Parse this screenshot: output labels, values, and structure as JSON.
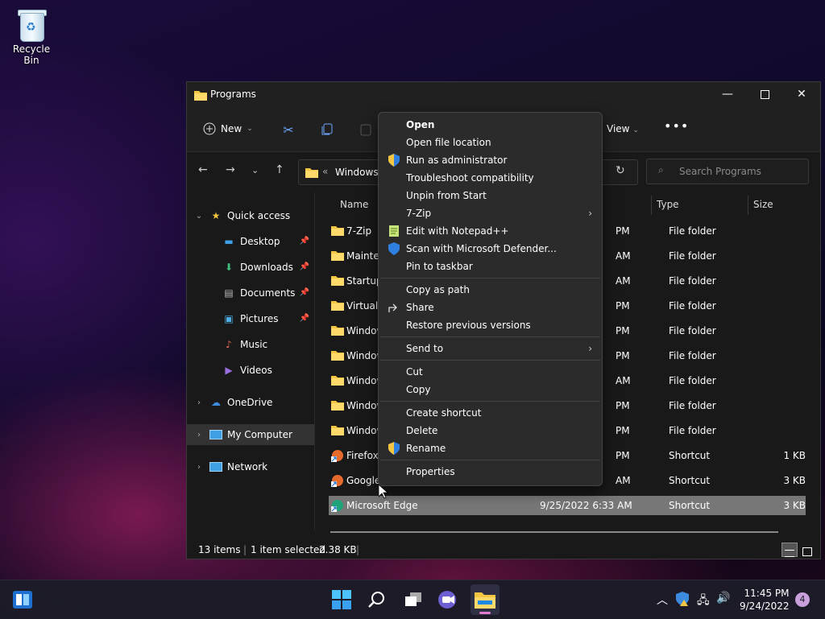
{
  "desktop": {
    "recycle_bin_label": "Recycle Bin"
  },
  "window": {
    "title": "Programs",
    "toolbar": {
      "new_label": "New",
      "view_label": "View"
    },
    "address": {
      "path_prefix": "«",
      "path_text": "Windows"
    },
    "search_placeholder": "Search Programs"
  },
  "nav": {
    "quick_access": "Quick access",
    "items": [
      {
        "label": "Desktop",
        "icon": "desktop-icon",
        "pinned": true
      },
      {
        "label": "Downloads",
        "icon": "download-icon",
        "pinned": true
      },
      {
        "label": "Documents",
        "icon": "document-icon",
        "pinned": true
      },
      {
        "label": "Pictures",
        "icon": "picture-icon",
        "pinned": true
      },
      {
        "label": "Music",
        "icon": "music-icon",
        "pinned": false
      },
      {
        "label": "Videos",
        "icon": "video-icon",
        "pinned": false
      }
    ],
    "onedrive": "OneDrive",
    "my_computer": "My Computer",
    "network": "Network"
  },
  "columns": {
    "name": "Name",
    "type": "Type",
    "size": "Size"
  },
  "files": [
    {
      "name": "7-Zip",
      "date": "PM",
      "type": "File folder",
      "size": ""
    },
    {
      "name": "Mainter",
      "date": "AM",
      "type": "File folder",
      "size": ""
    },
    {
      "name": "Startup",
      "date": "AM",
      "type": "File folder",
      "size": ""
    },
    {
      "name": "Virtual /",
      "date": "PM",
      "type": "File folder",
      "size": ""
    },
    {
      "name": "Window",
      "date": "PM",
      "type": "File folder",
      "size": ""
    },
    {
      "name": "Window",
      "date": "PM",
      "type": "File folder",
      "size": ""
    },
    {
      "name": "Window",
      "date": "AM",
      "type": "File folder",
      "size": ""
    },
    {
      "name": "Window",
      "date": "PM",
      "type": "File folder",
      "size": ""
    },
    {
      "name": "Window",
      "date": "PM",
      "type": "File folder",
      "size": ""
    },
    {
      "name": "Firefox",
      "date": "PM",
      "type": "Shortcut",
      "size": "1 KB"
    },
    {
      "name": "Google",
      "date": "AM",
      "type": "Shortcut",
      "size": "3 KB"
    },
    {
      "name": "Microsoft Edge",
      "date": "9/25/2022 6:33 AM",
      "type": "Shortcut",
      "size": "3 KB"
    }
  ],
  "status": {
    "items": "13 items",
    "selected": "1 item selected",
    "size": "2.38 KB"
  },
  "context_menu": {
    "group1": [
      {
        "label": "Open",
        "icon": "",
        "bold": true
      },
      {
        "label": "Open file location",
        "icon": ""
      },
      {
        "label": "Run as administrator",
        "icon": "uac-shield-icon"
      },
      {
        "label": "Troubleshoot compatibility",
        "icon": ""
      },
      {
        "label": "Unpin from Start",
        "icon": ""
      },
      {
        "label": "7-Zip",
        "icon": "",
        "submenu": true
      },
      {
        "label": "Edit with Notepad++",
        "icon": "notepad-plus-icon"
      },
      {
        "label": "Scan with Microsoft Defender...",
        "icon": "defender-shield-icon"
      },
      {
        "label": "Pin to taskbar",
        "icon": ""
      }
    ],
    "group2": [
      {
        "label": "Copy as path",
        "icon": ""
      },
      {
        "label": "Share",
        "icon": "share-icon"
      },
      {
        "label": "Restore previous versions",
        "icon": ""
      }
    ],
    "group3": [
      {
        "label": "Send to",
        "icon": "",
        "submenu": true
      }
    ],
    "group4": [
      {
        "label": "Cut",
        "icon": ""
      },
      {
        "label": "Copy",
        "icon": ""
      }
    ],
    "group5": [
      {
        "label": "Create shortcut",
        "icon": ""
      },
      {
        "label": "Delete",
        "icon": ""
      },
      {
        "label": "Rename",
        "icon": "uac-shield-icon"
      }
    ],
    "group6": [
      {
        "label": "Properties",
        "icon": ""
      }
    ]
  },
  "taskbar": {
    "time": "11:45 PM",
    "date": "9/24/2022",
    "notification_count": "4"
  },
  "colors": {
    "accent": "#0078d4",
    "folder": "#f4c542",
    "window_bg": "#191919"
  }
}
